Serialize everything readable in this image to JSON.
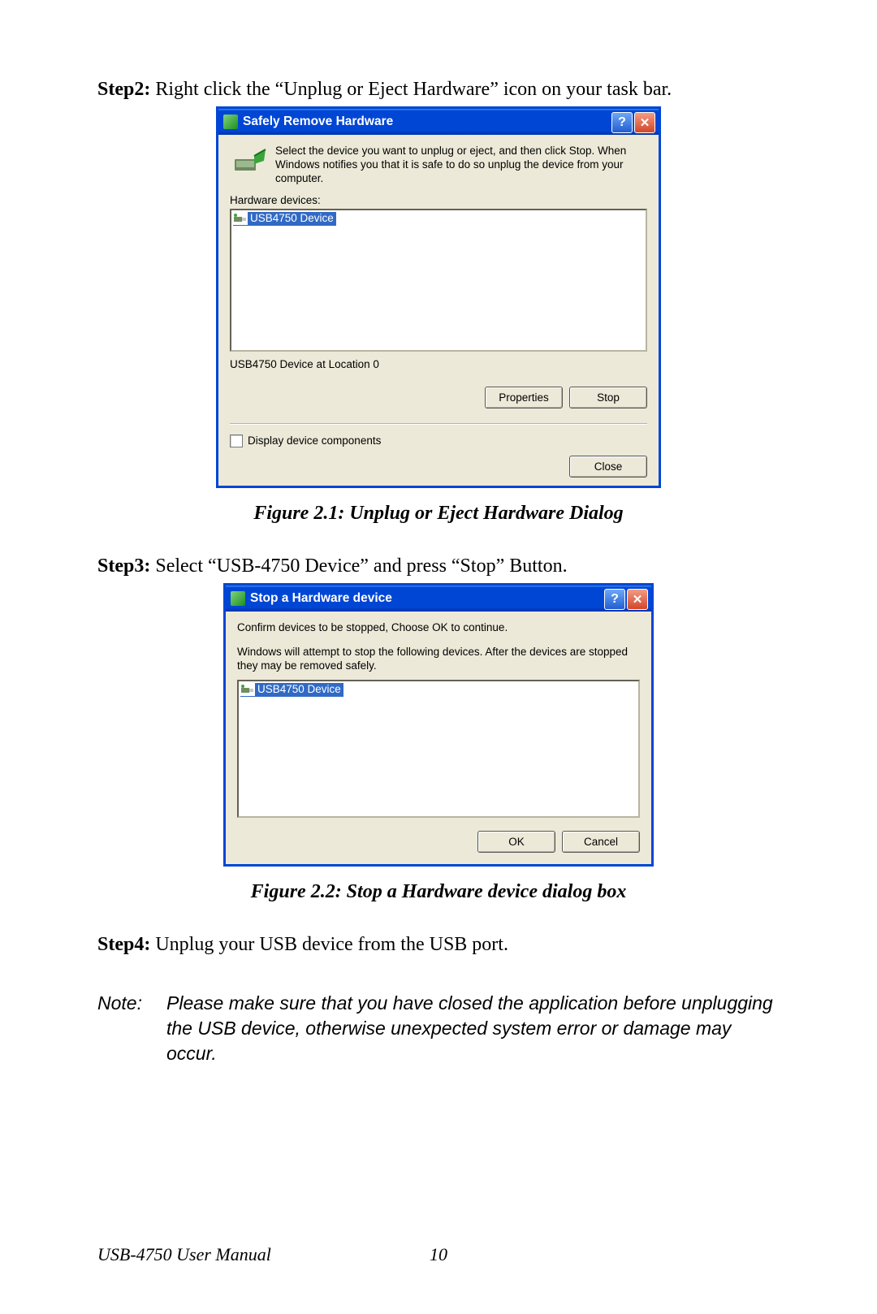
{
  "step2": {
    "label": "Step2:",
    "text": " Right click the “Unplug or Eject Hardware” icon on your task bar."
  },
  "figure1": {
    "caption": "Figure 2.1: Unplug or Eject Hardware Dialog"
  },
  "step3": {
    "label": "Step3:",
    "text": " Select “USB-4750 Device” and press “Stop” Button."
  },
  "figure2": {
    "caption": "Figure 2.2: Stop a Hardware device dialog box"
  },
  "step4": {
    "label": "Step4:",
    "text": " Unplug your USB device from the USB port."
  },
  "note": {
    "label": "Note:",
    "text": "Please make sure that you have closed the application before unplugging the USB device, otherwise unexpected system error or damage may occur."
  },
  "dialog1": {
    "title": "Safely Remove Hardware",
    "intro": "Select the device you want to unplug or eject, and then click Stop. When Windows notifies you that it is safe to do so unplug the device from your computer.",
    "list_label": "Hardware devices:",
    "device": "USB4750 Device",
    "status": "USB4750 Device at Location 0",
    "btn_properties": "Properties",
    "btn_stop": "Stop",
    "chk_label": "Display device components",
    "btn_close": "Close"
  },
  "dialog2": {
    "title": "Stop a Hardware device",
    "confirm": "Confirm devices to be stopped, Choose OK to continue.",
    "attempt": "Windows will attempt to stop the following devices. After the devices are stopped they may be removed safely.",
    "device": "USB4750 Device",
    "btn_ok": "OK",
    "btn_cancel": "Cancel"
  },
  "footer": {
    "manual": "USB-4750 User Manual",
    "page": "10"
  }
}
